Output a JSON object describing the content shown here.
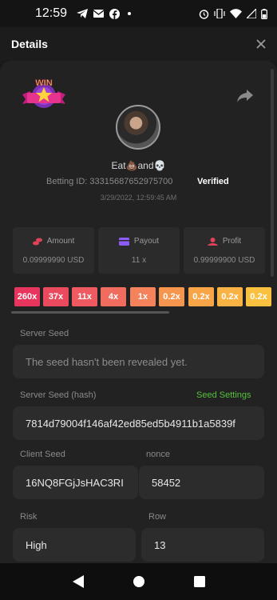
{
  "status_bar": {
    "time": "12:59",
    "left_icons": [
      "telegram-icon",
      "mail-icon",
      "facebook-icon",
      "dot-icon"
    ],
    "right_icons": [
      "alarm-icon",
      "vibrate-icon",
      "wifi-icon",
      "signal-icon",
      "battery-icon"
    ]
  },
  "header": {
    "title": "Details",
    "close_icon": "close-icon"
  },
  "badge": {
    "text": "WIN"
  },
  "user": {
    "name": "Eat💩and💀",
    "betting_id_label": "Betting ID: 33315687652975700",
    "verified": "Verified",
    "timestamp": "3/29/2022, 12:59:45 AM"
  },
  "stats": [
    {
      "label": "Amount",
      "value": "0.09999990 USD",
      "icon": "coins-icon",
      "color": "#e0425a"
    },
    {
      "label": "Payout",
      "value": "11 x",
      "icon": "wallet-icon",
      "color": "#8b5cf6"
    },
    {
      "label": "Profit",
      "value": "0.99999900 USD",
      "icon": "profit-icon",
      "color": "#e0425a"
    }
  ],
  "multipliers": [
    {
      "text": "260x",
      "color": "#e8355d"
    },
    {
      "text": "37x",
      "color": "#ea4a5e"
    },
    {
      "text": "11x",
      "color": "#ee5a60"
    },
    {
      "text": "4x",
      "color": "#f06c5e"
    },
    {
      "text": "1x",
      "color": "#f4825a"
    },
    {
      "text": "0.2x",
      "color": "#f6964e"
    },
    {
      "text": "0.2x",
      "color": "#f8a548"
    },
    {
      "text": "0.2x",
      "color": "#f9b344"
    },
    {
      "text": "0.2x",
      "color": "#fac040"
    }
  ],
  "server_seed": {
    "label": "Server Seed",
    "value": "The seed hasn't been revealed yet."
  },
  "server_seed_hash": {
    "label": "Server Seed (hash)",
    "settings_link": "Seed Settings",
    "value": "7814d79004f146af42ed85ed5b4911b1a5839f"
  },
  "client_seed": {
    "label": "Client Seed",
    "value": "16NQ8FGjJsHAC3RI"
  },
  "nonce": {
    "label": "nonce",
    "value": "58452"
  },
  "risk": {
    "label": "Risk",
    "value": "High"
  },
  "row": {
    "label": "Row",
    "value": "13"
  },
  "nav": [
    "back-icon",
    "home-icon",
    "recents-icon"
  ]
}
